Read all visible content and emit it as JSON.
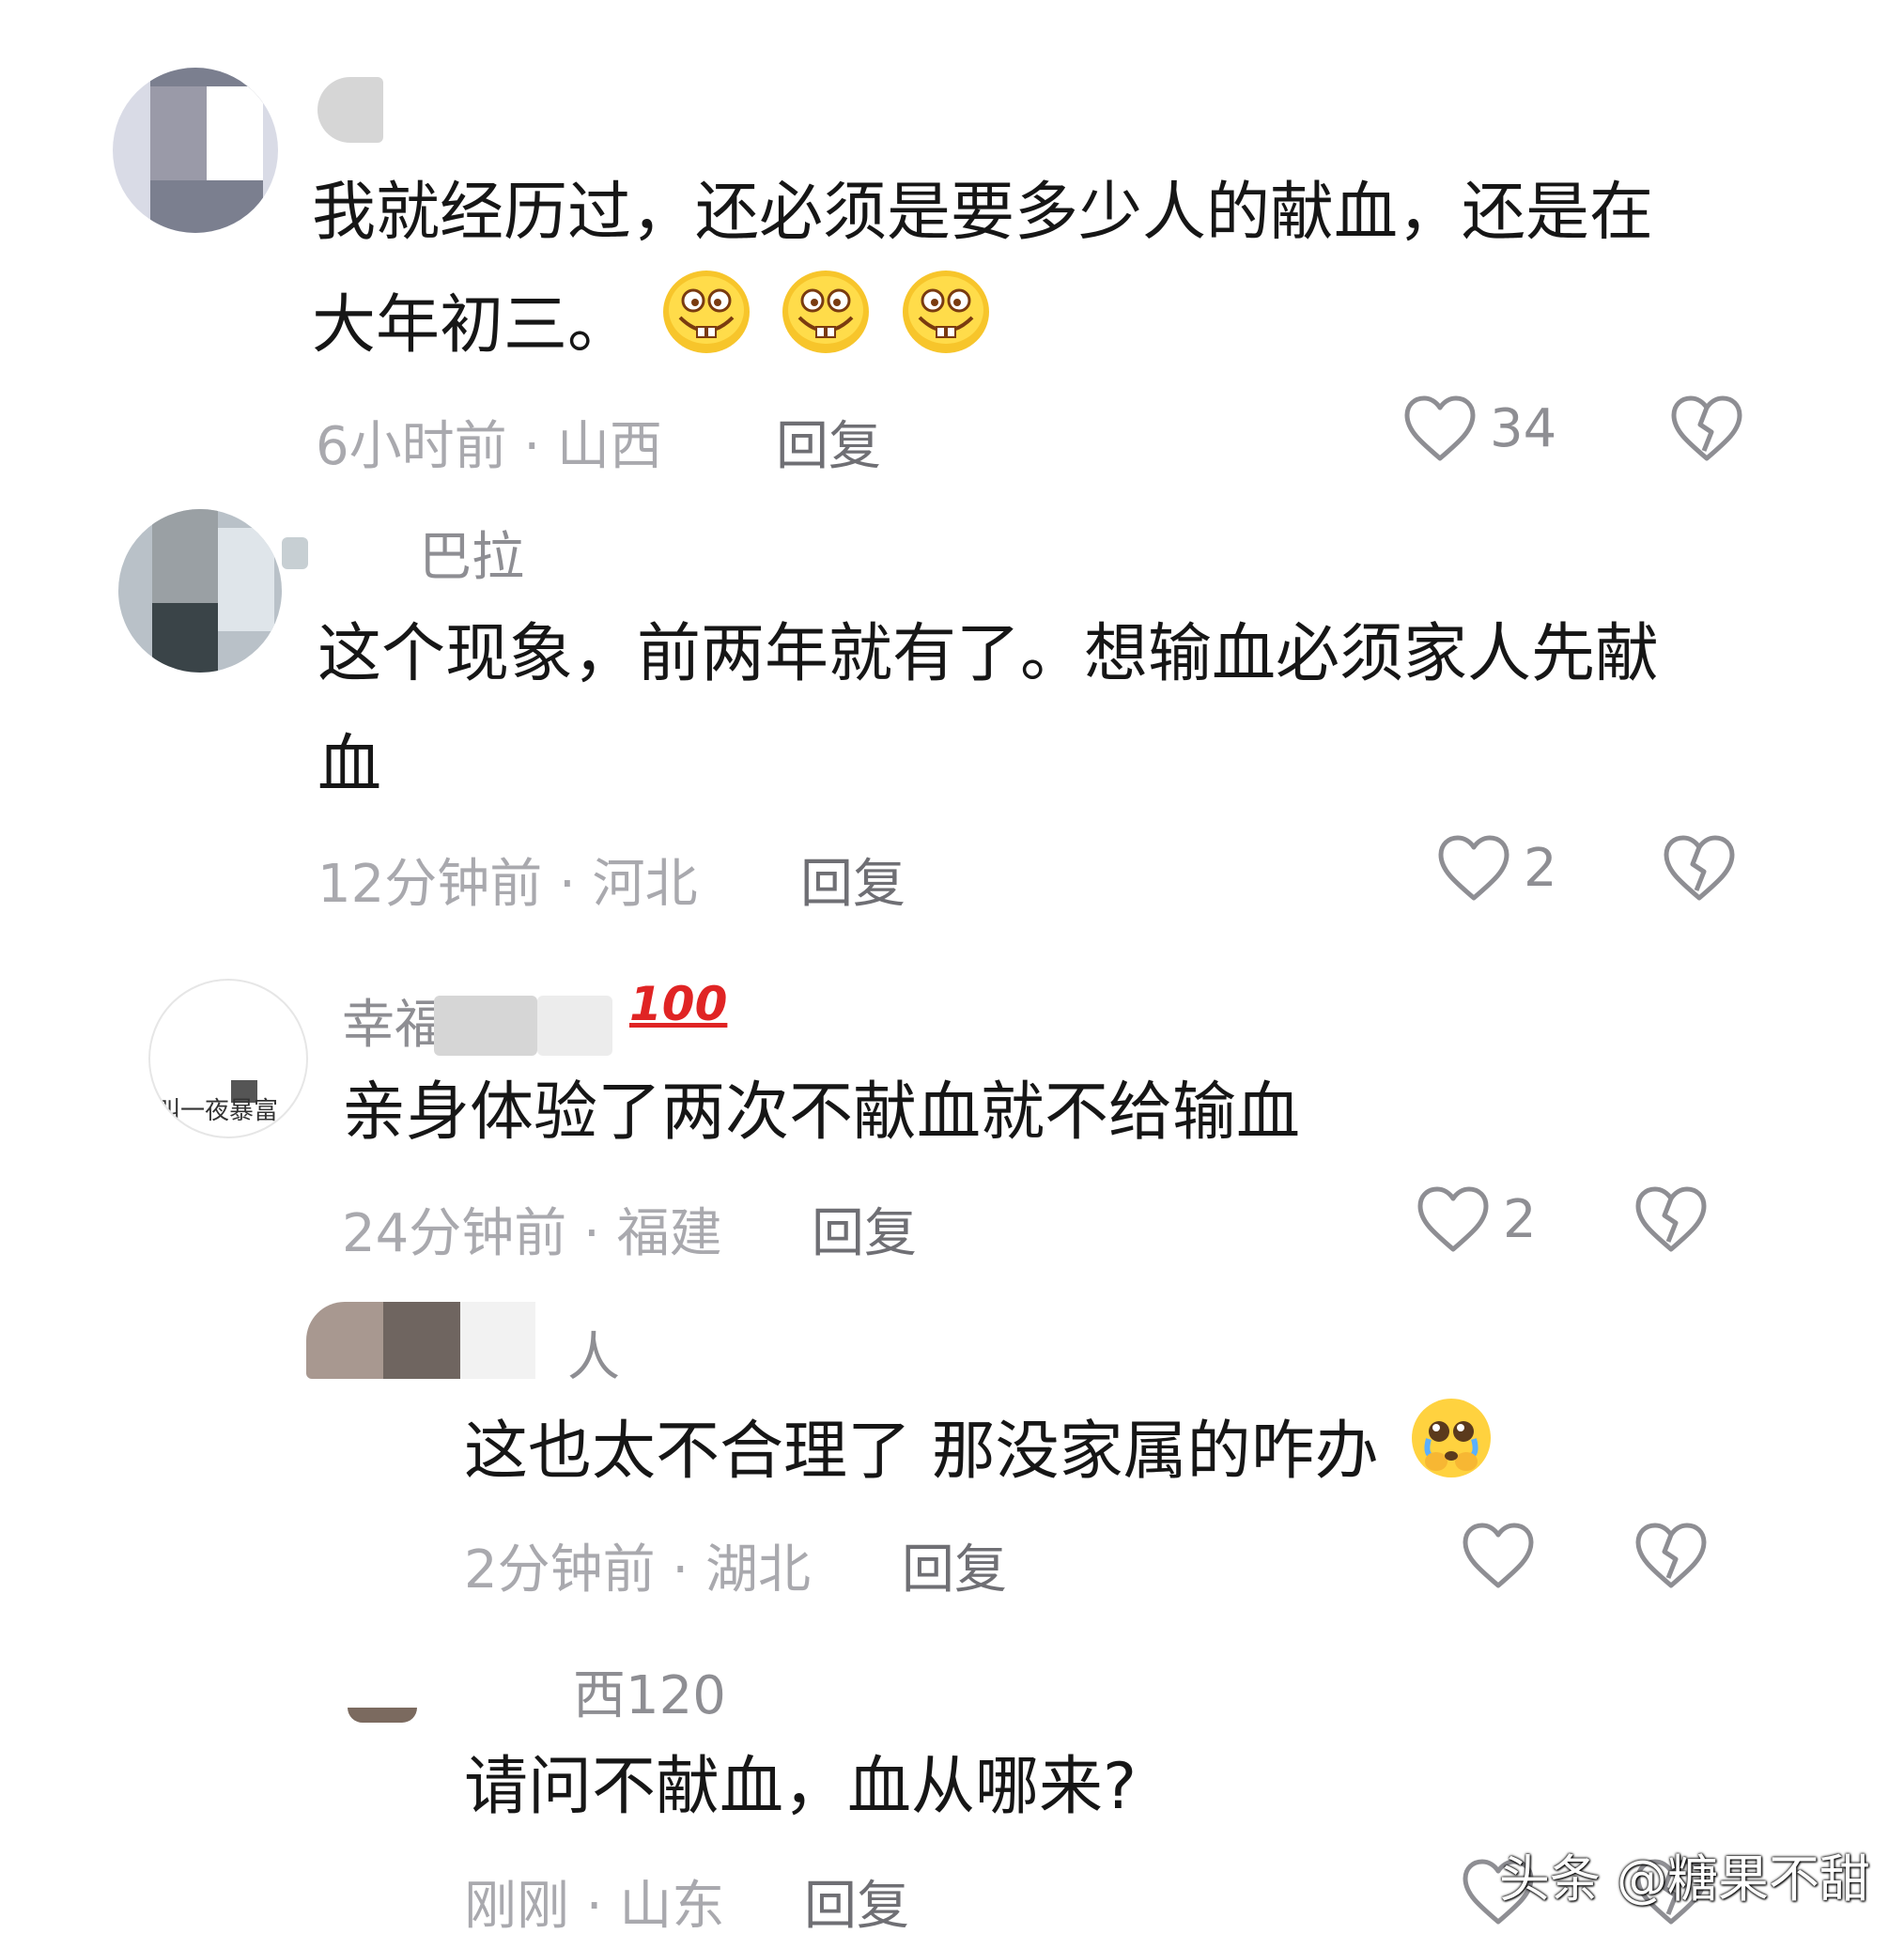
{
  "comments": [
    {
      "username": "",
      "text_line1": "我就经历过，还必须是要多少人的献血，还是在",
      "text_line2": "大年初三。",
      "emoji": "grinning-buck-teeth-emoji",
      "time_location": "6小时前 · 山西",
      "reply_label": "回复",
      "likes": "34"
    },
    {
      "username": "巴拉",
      "text_line1": "这个现象，前两年就有了。想输血必须家人先献",
      "text_line2": "血",
      "time_location": "12分钟前 · 河北",
      "reply_label": "回复",
      "likes": "2"
    },
    {
      "username": "幸福",
      "badge": "100",
      "avatar_text": "叫一夜暴富",
      "text_line1": "亲身体验了两次不献血就不给输血",
      "time_location": "24分钟前 · 福建",
      "reply_label": "回复",
      "likes": "2"
    },
    {
      "username": "人",
      "text_line1": "这也太不合理了 那没家属的咋办",
      "emoji": "pleading-tears-emoji",
      "time_location": "2分钟前 · 湖北",
      "reply_label": "回复",
      "likes": ""
    },
    {
      "username": "西120",
      "text_line1": "请问不献血，血从哪来?",
      "time_location": "刚刚 · 山东",
      "reply_label": "回复",
      "likes": ""
    }
  ],
  "watermark": "头条 @糖果不甜",
  "icons": {
    "like": "heart-outline-icon",
    "dislike": "broken-heart-icon"
  },
  "colors": {
    "text": "#161616",
    "meta": "#a9a9ae",
    "icon": "#8e8e93"
  }
}
